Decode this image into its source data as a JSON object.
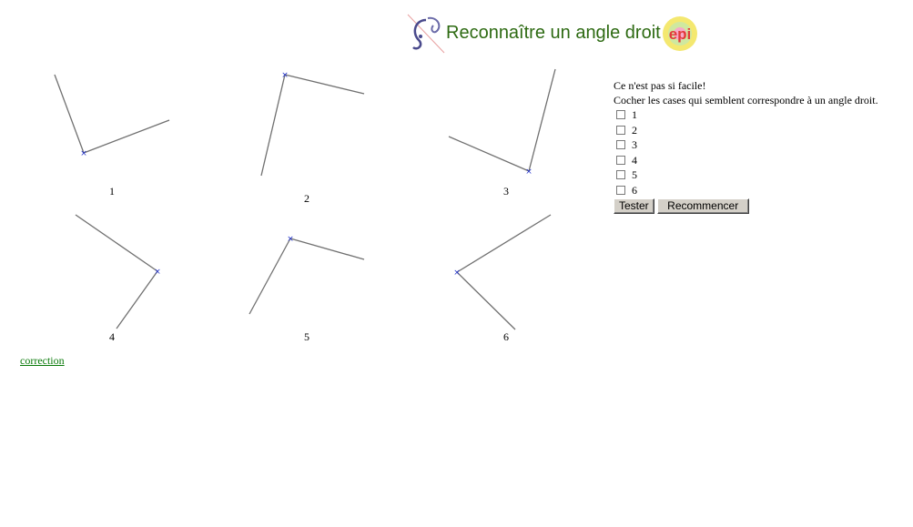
{
  "header": {
    "title": "Reconnaître un angle droit",
    "logo_left_icon": "curl-logo-icon",
    "logo_right_text": "epi",
    "title_color": "#2d6a12"
  },
  "figures": [
    {
      "label": "1"
    },
    {
      "label": "2"
    },
    {
      "label": "3"
    },
    {
      "label": "4"
    },
    {
      "label": "5"
    },
    {
      "label": "6"
    }
  ],
  "panel": {
    "line1": "Ce n'est pas si facile!",
    "line2": "Cocher les cases qui semblent correspondre à un angle droit.",
    "choices": [
      {
        "label": "1",
        "checked": false
      },
      {
        "label": "2",
        "checked": false
      },
      {
        "label": "3",
        "checked": false
      },
      {
        "label": "4",
        "checked": false
      },
      {
        "label": "5",
        "checked": false
      },
      {
        "label": "6",
        "checked": false
      }
    ],
    "test_button": "Tester",
    "reset_button": "Recommencer"
  },
  "footer": {
    "correction_link": "correction",
    "link_color": "#0a7a0a"
  }
}
